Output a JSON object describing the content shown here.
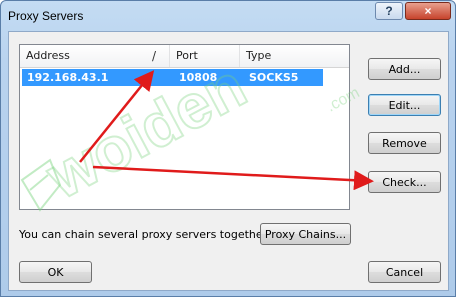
{
  "window": {
    "title": "Proxy Servers"
  },
  "titlebar": {
    "help_label": "?",
    "close_label": "×"
  },
  "list": {
    "columns": [
      "Address",
      "Port",
      "Type"
    ],
    "sort_glyph": "/",
    "rows": [
      {
        "address": "192.168.43.1",
        "port": "10808",
        "type": "SOCKS5"
      }
    ]
  },
  "buttons": {
    "add": "Add...",
    "edit": "Edit...",
    "remove": "Remove",
    "check": "Check...",
    "proxy_chains": "Proxy Chains...",
    "ok": "OK",
    "cancel": "Cancel"
  },
  "chain_text": "You can chain several proxy servers together:",
  "watermark": {
    "text": "woiden",
    "domain": ".com"
  },
  "colors": {
    "selection": "#3399ff",
    "arrow": "#e01b1b",
    "watermark": "#7ad37e"
  }
}
